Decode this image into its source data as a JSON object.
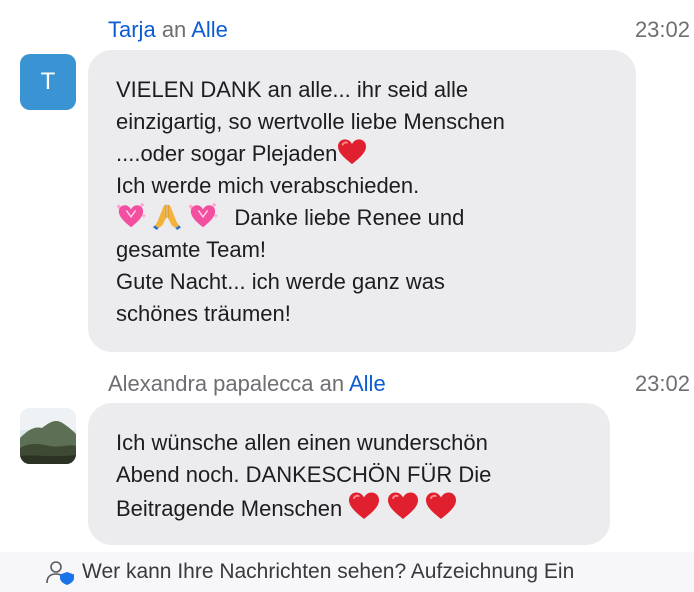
{
  "colors": {
    "accent": "#0b5cd5",
    "bubble": "#ececef",
    "avatar_t": "#3a93d3",
    "heart": "#e0202f",
    "pink_hearts": "#f24fa0",
    "shield": "#1a73e8"
  },
  "messages": [
    {
      "sender": "Tarja",
      "an": "an",
      "recipient": "Alle",
      "time": "23:02",
      "avatar_letter": "T",
      "lines": [
        "VIELEN DANK an alle... ihr seid alle",
        "einzigartig, so wertvolle liebe Menschen",
        "....oder sogar Plejaden",
        "Ich werde mich verabschieden.",
        "Danke liebe Renee und",
        "gesamte Team!",
        "Gute Nacht... ich werde ganz was",
        "schönes träumen!"
      ],
      "emojis": [
        "red-heart",
        "heart-with-sparkles",
        "folded-hands",
        "heart-with-sparkles"
      ]
    },
    {
      "sender": "Alexandra papalecca",
      "an": "an",
      "recipient": "Alle",
      "time": "23:02",
      "avatar": "landscape-photo",
      "lines": [
        "Ich wünsche allen einen wunderschön",
        "Abend noch. DANKESCHÖN FÜR Die",
        "Beitragende Menschen"
      ],
      "emojis": [
        "red-heart",
        "red-heart",
        "red-heart"
      ]
    }
  ],
  "footer": {
    "icon": "person-shield-icon",
    "text": "Wer kann Ihre Nachrichten sehen? Aufzeichnung Ein"
  }
}
